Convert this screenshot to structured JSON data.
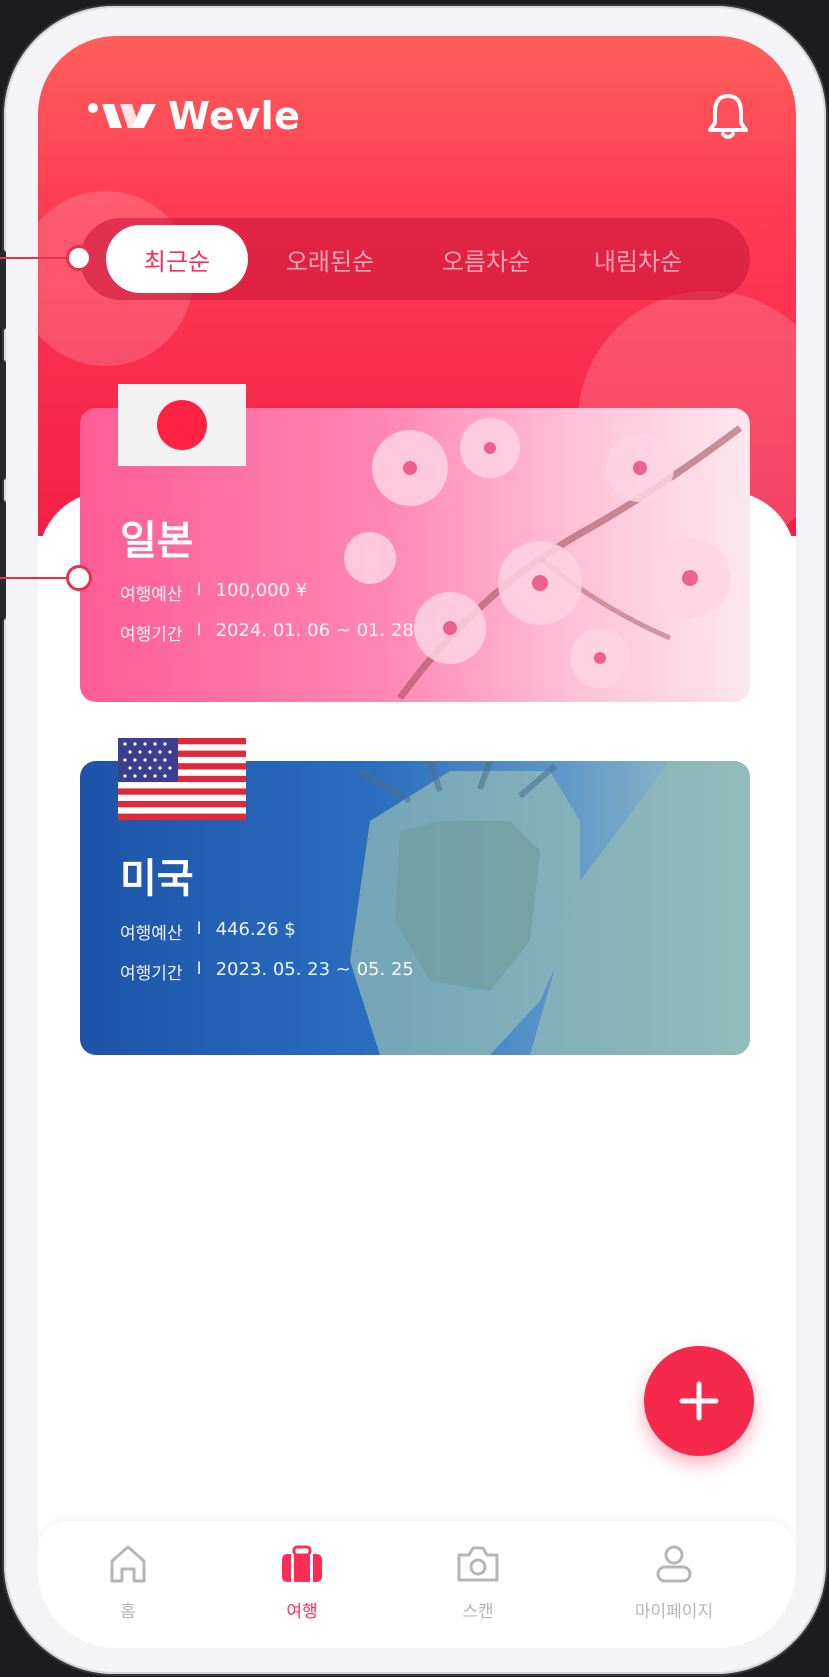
{
  "app": {
    "name": "Wevle"
  },
  "colors": {
    "accent": "#ff2d55",
    "hero": "#f31f47",
    "fab": "#f4294c"
  },
  "header": {
    "bell_icon": "bell-icon"
  },
  "sort": {
    "tabs": [
      {
        "label": "최근순",
        "active": true
      },
      {
        "label": "오래된순",
        "active": false
      },
      {
        "label": "오름차순",
        "active": false
      },
      {
        "label": "내림차순",
        "active": false
      }
    ]
  },
  "trips": [
    {
      "country": "일본",
      "flag": "japan-flag",
      "budget_label": "여행예산",
      "budget": "100,000 ¥",
      "period_label": "여행기간",
      "period": "2024. 01. 06 ~ 01. 28"
    },
    {
      "country": "미국",
      "flag": "usa-flag",
      "budget_label": "여행예산",
      "budget": "446.26 $",
      "period_label": "여행기간",
      "period": "2023. 05. 23 ~ 05. 25"
    }
  ],
  "separator": "I",
  "fab": {
    "icon": "plus-icon"
  },
  "nav": {
    "items": [
      {
        "label": "홈",
        "icon": "home-icon",
        "active": false
      },
      {
        "label": "여행",
        "icon": "suitcase-icon",
        "active": true
      },
      {
        "label": "스캔",
        "icon": "camera-icon",
        "active": false
      },
      {
        "label": "마이페이지",
        "icon": "user-icon",
        "active": false
      }
    ]
  }
}
